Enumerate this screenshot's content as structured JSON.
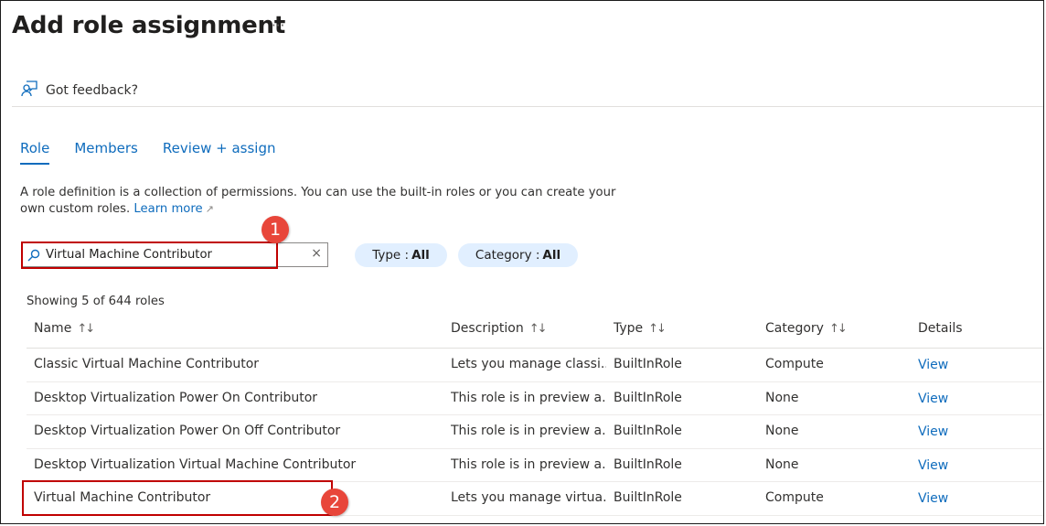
{
  "header": {
    "title": "Add role assignment",
    "more_label": "···"
  },
  "feedback": {
    "label": "Got feedback?",
    "icon": "feedback-person-icon"
  },
  "tabs": [
    {
      "label": "Role",
      "active": true
    },
    {
      "label": "Members",
      "active": false
    },
    {
      "label": "Review + assign",
      "active": false
    }
  ],
  "description": {
    "text": "A role definition is a collection of permissions. You can use the built-in roles or you can create your own custom roles.",
    "link_label": "Learn more"
  },
  "search": {
    "value": "Virtual Machine Contributor",
    "clear_label": "×"
  },
  "filters": {
    "type": {
      "label": "Type :",
      "value": "All"
    },
    "category": {
      "label": "Category :",
      "value": "All"
    }
  },
  "results_count": "Showing 5 of 644 roles",
  "table": {
    "columns": [
      {
        "label": "Name",
        "sortable": true
      },
      {
        "label": "Description",
        "sortable": true
      },
      {
        "label": "Type",
        "sortable": true
      },
      {
        "label": "Category",
        "sortable": true
      },
      {
        "label": "Details",
        "sortable": false
      }
    ],
    "sort_icon": "↑↓",
    "rows": [
      {
        "name": "Classic Virtual Machine Contributor",
        "description": "Lets you manage classi...",
        "type": "BuiltInRole",
        "category": "Compute",
        "details": "View"
      },
      {
        "name": "Desktop Virtualization Power On Contributor",
        "description": "This role is in preview a...",
        "type": "BuiltInRole",
        "category": "None",
        "details": "View"
      },
      {
        "name": "Desktop Virtualization Power On Off Contributor",
        "description": "This role is in preview a...",
        "type": "BuiltInRole",
        "category": "None",
        "details": "View"
      },
      {
        "name": "Desktop Virtualization Virtual Machine Contributor",
        "description": "This role is in preview a...",
        "type": "BuiltInRole",
        "category": "None",
        "details": "View"
      },
      {
        "name": "Virtual Machine Contributor",
        "description": "Lets you manage virtua...",
        "type": "BuiltInRole",
        "category": "Compute",
        "details": "View"
      }
    ]
  },
  "callouts": [
    "1",
    "2"
  ],
  "colors": {
    "accent": "#0f6cbd",
    "pill_bg": "#e1efff",
    "highlight": "#c00000",
    "callout": "#e8463a"
  }
}
